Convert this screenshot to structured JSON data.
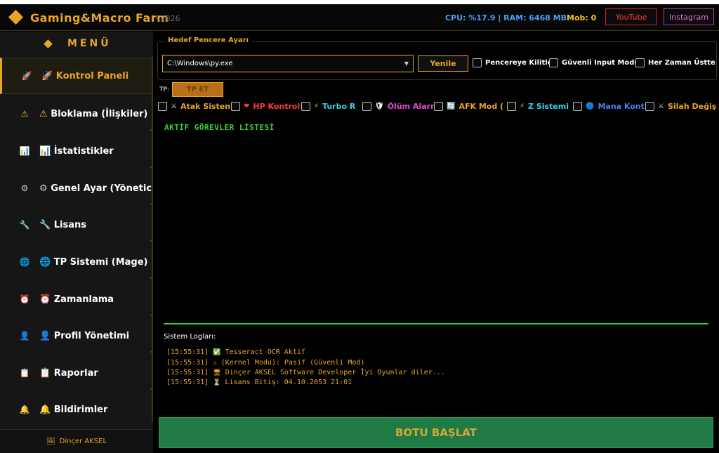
{
  "app": {
    "title": "Gaming&Macro Farm",
    "version": "v2026",
    "cpu_ram": "CPU: %17.9 | RAM: 6468 MB",
    "mob": "Mob: 0",
    "youtube_label": "YouTube",
    "instagram_label": "Instagram"
  },
  "sidebar": {
    "menu_title": "MENÜ",
    "items": [
      {
        "icon": "🚀",
        "label": "Kontrol Paneli",
        "active": true
      },
      {
        "icon": "⚠",
        "label": "Bloklama (İlişkiler)"
      },
      {
        "icon": "📊",
        "label": "İstatistikler"
      },
      {
        "icon": "⚙",
        "label": "Genel Ayar (Yönetici)"
      },
      {
        "icon": "🔧",
        "label": "Lisans"
      },
      {
        "icon": "🌐",
        "label": "TP Sistemi (Mage)"
      },
      {
        "icon": "⏰",
        "label": "Zamanlama"
      },
      {
        "icon": "👤",
        "label": "Profil Yönetimi"
      },
      {
        "icon": "📋",
        "label": "Raporlar"
      },
      {
        "icon": "🔔",
        "label": "Bildirimler"
      }
    ],
    "footer": "Dinçer AKSEL"
  },
  "window_settings": {
    "legend": "Hedef Pencere Ayarı",
    "path": "C:\\Windows\\py.exe",
    "refresh_label": "Yenile",
    "options": [
      "Pencereye Kilitle",
      "Güvenli Input Modu",
      "Her Zaman Üstte"
    ]
  },
  "tp": {
    "label": "TP:",
    "button": "TP ET"
  },
  "features": [
    {
      "icon": "⚔",
      "label": "Atak Sisten",
      "color": "#e8a626"
    },
    {
      "icon": "❤",
      "label": "HP Kontrol",
      "color": "#ff3b3b"
    },
    {
      "icon": "⚡",
      "label": "Turbo R",
      "color": "#33d3e8"
    },
    {
      "icon": "🛡",
      "label": "Ölüm Alarn",
      "color": "#e84ad8"
    },
    {
      "icon": "🔄",
      "label": "AFK Mod (",
      "color": "#e8a626"
    },
    {
      "icon": "⚡",
      "label": "Z Sistemi",
      "color": "#33d3e8"
    },
    {
      "icon": "🔵",
      "label": "Mana Kont",
      "color": "#4a7ef5"
    },
    {
      "icon": "⚔",
      "label": "Silah Değiş",
      "color": "#e8a626"
    }
  ],
  "tasks": {
    "title": "AKTİF GÖREVLER LİSTESİ"
  },
  "logs": {
    "title": "Sistem Logları:",
    "entries": [
      {
        "time": "[15:55:31]",
        "icon": "✅",
        "text": "Tesseract OCR Aktif"
      },
      {
        "time": "[15:55:31]",
        "icon": "⚠",
        "text": "(Kernel Modu): Pasif (Güvenli Mod)"
      },
      {
        "time": "[15:55:31]",
        "icon": "🖥",
        "text": "Dinçer AKSEL Software Developer İyi Oyunlar diler..."
      },
      {
        "time": "[15:55:31]",
        "icon": "⏳",
        "text": "Lisans Bitiş: 04.10.2053 21:01"
      }
    ]
  },
  "start_button": "BOTU BAŞLAT"
}
